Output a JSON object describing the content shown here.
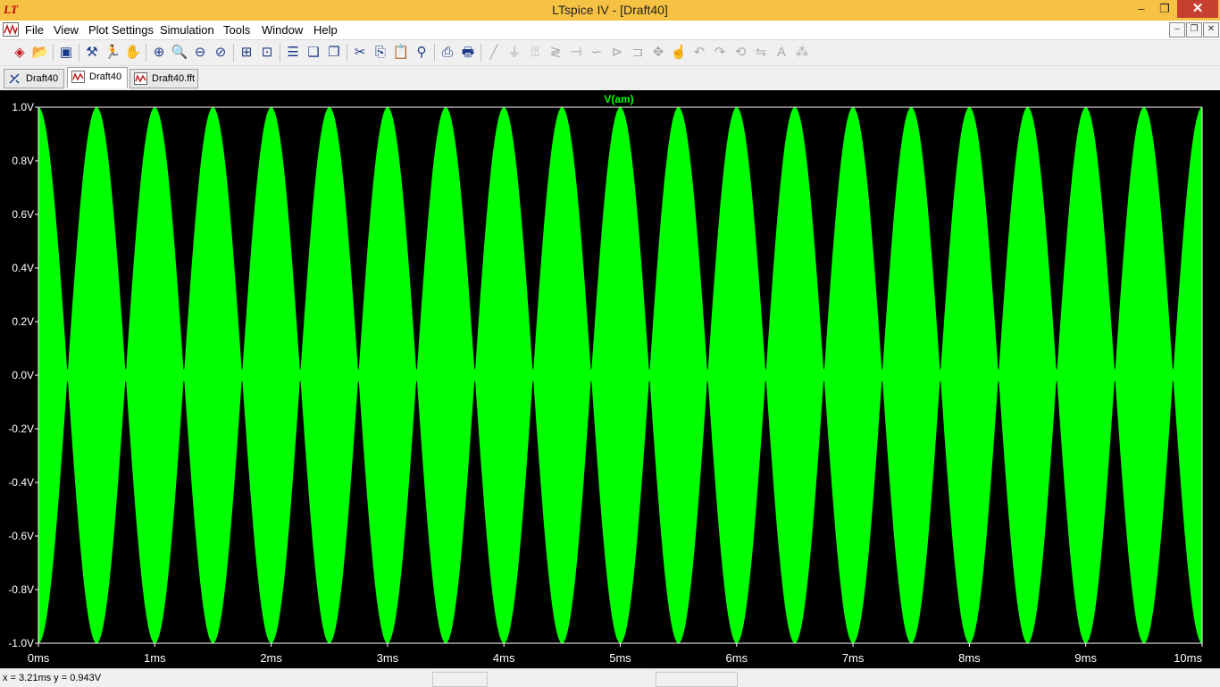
{
  "window": {
    "app_icon": "ltspice-logo-icon",
    "title": "LTspice IV - [Draft40]",
    "minimize_glyph": "–",
    "maximize_glyph": "❐",
    "close_glyph": "✕"
  },
  "menu": {
    "items": [
      "File",
      "View",
      "Plot Settings",
      "Simulation",
      "Tools",
      "Window",
      "Help"
    ],
    "mdi_minimize": "–",
    "mdi_restore": "❐",
    "mdi_close": "✕"
  },
  "toolbar": {
    "icons": [
      {
        "name": "new-schematic-icon",
        "glyph": "◈"
      },
      {
        "name": "open-icon",
        "glyph": "📂"
      },
      {
        "name": "save-icon",
        "glyph": "▣"
      },
      {
        "name": "control-panel-icon",
        "glyph": "⚒"
      },
      {
        "name": "run-icon",
        "glyph": "🏃"
      },
      {
        "name": "halt-icon",
        "glyph": "✋"
      },
      {
        "name": "zoom-area-icon",
        "glyph": "⊕"
      },
      {
        "name": "zoom-in-icon",
        "glyph": "🔍"
      },
      {
        "name": "zoom-out-icon",
        "glyph": "⊖"
      },
      {
        "name": "zoom-cancel-icon",
        "glyph": "⊘"
      },
      {
        "name": "autorange-icon",
        "glyph": "⊞"
      },
      {
        "name": "zoom-fit-icon",
        "glyph": "⊡"
      },
      {
        "name": "tile-horizontal-icon",
        "glyph": "☰"
      },
      {
        "name": "cascade-icon",
        "glyph": "❏"
      },
      {
        "name": "tile-vertical-icon",
        "glyph": "❐"
      },
      {
        "name": "cut-icon",
        "glyph": "✂"
      },
      {
        "name": "copy-icon",
        "glyph": "⎘"
      },
      {
        "name": "paste-icon",
        "glyph": "📋"
      },
      {
        "name": "find-icon",
        "glyph": "⚲"
      },
      {
        "name": "print-preview-icon",
        "glyph": "⎙"
      },
      {
        "name": "print-icon",
        "glyph": "🖶"
      },
      {
        "name": "wire-icon",
        "glyph": "╱"
      },
      {
        "name": "ground-icon",
        "glyph": "⏚"
      },
      {
        "name": "label-net-icon",
        "glyph": "⍰"
      },
      {
        "name": "resistor-icon",
        "glyph": "≷"
      },
      {
        "name": "capacitor-icon",
        "glyph": "⊣"
      },
      {
        "name": "inductor-icon",
        "glyph": "∽"
      },
      {
        "name": "diode-icon",
        "glyph": "⊳"
      },
      {
        "name": "component-icon",
        "glyph": "⊐"
      },
      {
        "name": "move-icon",
        "glyph": "✥"
      },
      {
        "name": "drag-icon",
        "glyph": "☝"
      },
      {
        "name": "undo-icon",
        "glyph": "↶"
      },
      {
        "name": "redo-icon",
        "glyph": "↷"
      },
      {
        "name": "rotate-icon",
        "glyph": "⟲"
      },
      {
        "name": "mirror-icon",
        "glyph": "⇋"
      },
      {
        "name": "text-icon",
        "glyph": "A"
      },
      {
        "name": "spice-directive-icon",
        "glyph": "⁂"
      }
    ]
  },
  "tabs": [
    {
      "label": "Draft40",
      "icon": "schematic-icon",
      "active": false
    },
    {
      "label": "Draft40",
      "icon": "waveform-icon",
      "active": true
    },
    {
      "label": "Draft40.fft",
      "icon": "fft-waveform-icon",
      "active": false
    }
  ],
  "plot": {
    "background": "#000000",
    "trace_color": "#00ff00",
    "axis_color": "#ffffff"
  },
  "chart_data": {
    "type": "line",
    "title": "V(am)",
    "xlabel": "",
    "ylabel": "",
    "x_ticks": [
      "0ms",
      "1ms",
      "2ms",
      "3ms",
      "4ms",
      "5ms",
      "6ms",
      "7ms",
      "8ms",
      "9ms",
      "10ms"
    ],
    "y_ticks": [
      "1.0V",
      "0.8V",
      "0.6V",
      "0.4V",
      "0.2V",
      "0.0V",
      "-0.2V",
      "-0.4V",
      "-0.6V",
      "-0.8V",
      "-1.0V"
    ],
    "xlim_ms": [
      0,
      10
    ],
    "ylim_v": [
      -1.0,
      1.0
    ],
    "grid": false,
    "series": [
      {
        "name": "V(am)",
        "signal": "double-sideband suppressed-carrier AM: envelope |cos(2*pi*fm*t)|, carrier filling envelope",
        "envelope_frequency_hz": 1000,
        "envelope_lobes_per_ms": 2,
        "peak_v": 1.0,
        "envelope_peak_times_ms": [
          0,
          0.5,
          1,
          1.5,
          2,
          2.5,
          3,
          3.5,
          4,
          4.5,
          5,
          5.5,
          6,
          6.5,
          7,
          7.5,
          8,
          8.5,
          9,
          9.5,
          10
        ],
        "envelope_null_times_ms": [
          0.25,
          0.75,
          1.25,
          1.75,
          2.25,
          2.75,
          3.25,
          3.75,
          4.25,
          4.75,
          5.25,
          5.75,
          6.25,
          6.75,
          7.25,
          7.75,
          8.25,
          8.75,
          9.25,
          9.75
        ]
      }
    ]
  },
  "status": {
    "cursor": "x = 3.21ms    y = 0.943V"
  }
}
